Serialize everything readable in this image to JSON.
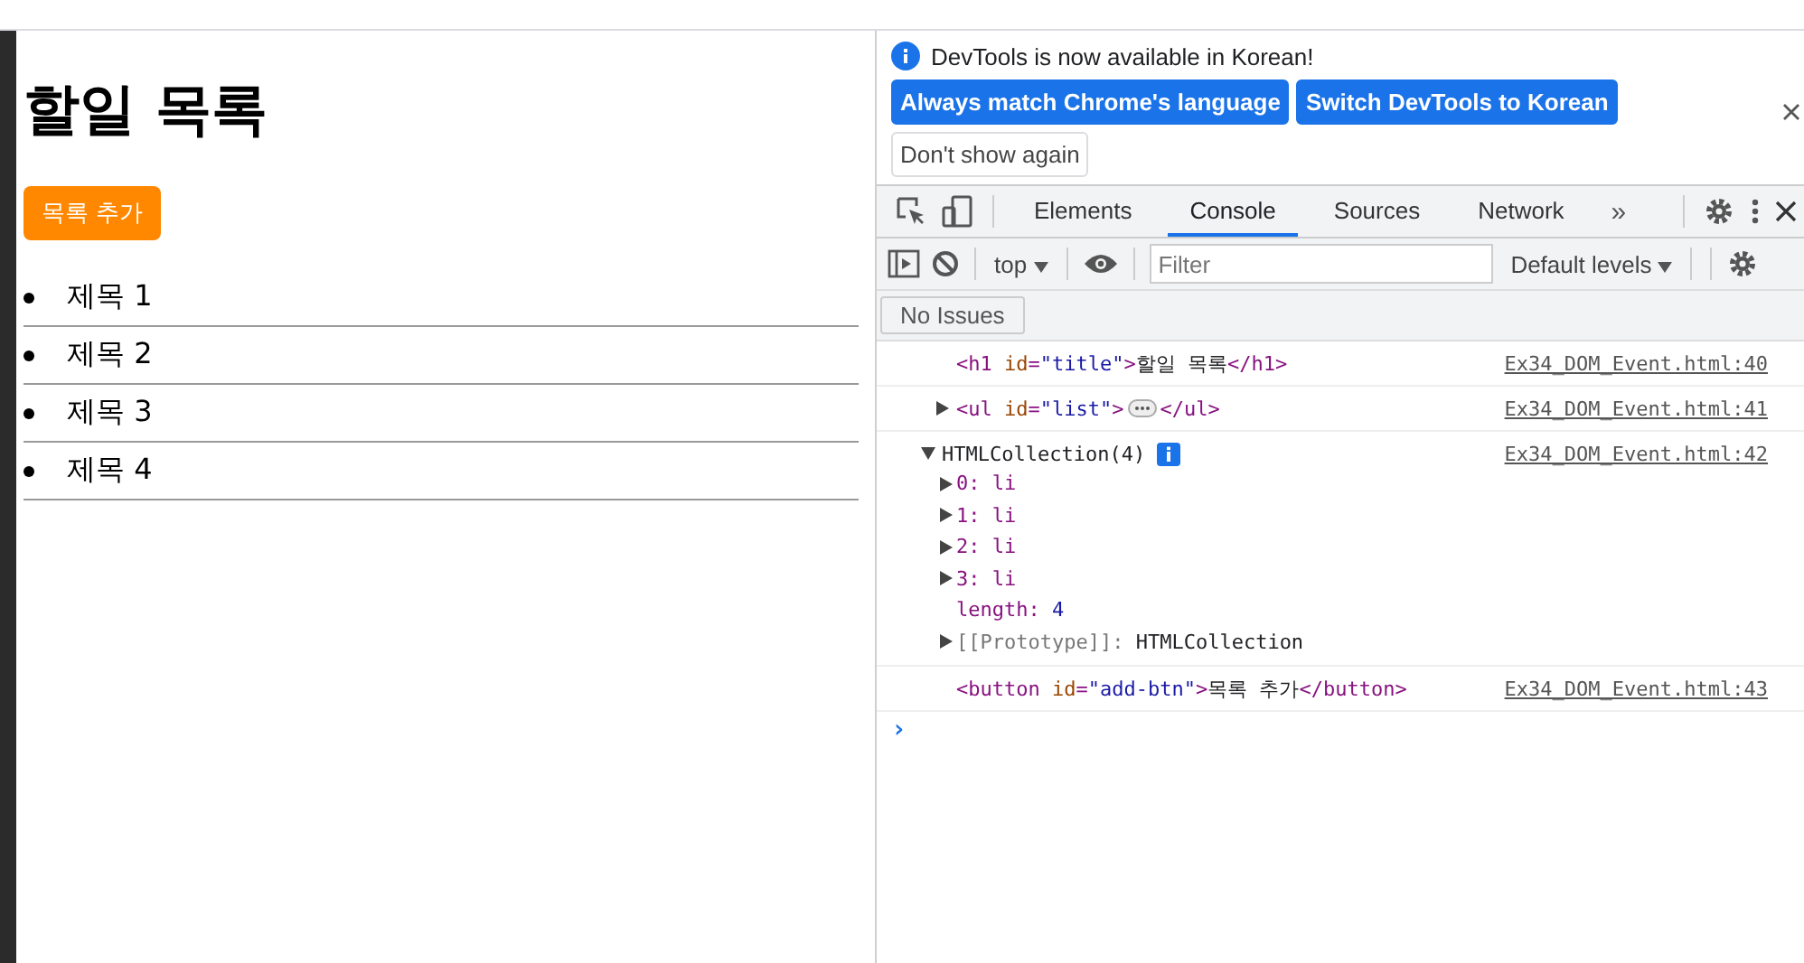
{
  "page": {
    "heading": "할일 목록",
    "add_button": "목록 추가",
    "items": [
      "제목 1",
      "제목 2",
      "제목 3",
      "제목 4"
    ]
  },
  "devtools": {
    "infobar": {
      "message": "DevTools is now available in Korean!",
      "buttons": [
        {
          "label": "Always match Chrome's language",
          "kind": "primary"
        },
        {
          "label": "Switch DevTools to Korean",
          "kind": "primary"
        },
        {
          "label": "Don't show again",
          "kind": "secondary"
        }
      ]
    },
    "tabs": [
      {
        "label": "Elements",
        "selected": false
      },
      {
        "label": "Console",
        "selected": true
      },
      {
        "label": "Sources",
        "selected": false
      },
      {
        "label": "Network",
        "selected": false
      }
    ],
    "more_tabs": "»",
    "context": "top",
    "filter": {
      "placeholder": "Filter"
    },
    "levels": "Default levels",
    "issues": "No Issues",
    "entries": [
      {
        "kind": "element",
        "tokens": [
          {
            "kind": "tag",
            "text": "<h1 "
          },
          {
            "kind": "attr",
            "text": "id"
          },
          {
            "kind": "tag",
            "text": "="
          },
          {
            "kind": "value",
            "text": "\"title\""
          },
          {
            "kind": "tag",
            "text": ">"
          },
          {
            "kind": "text",
            "text": "할일 목록"
          },
          {
            "kind": "tag",
            "text": "</h1>"
          }
        ],
        "source": "Ex34_DOM_Event.html:40"
      },
      {
        "kind": "collapsed",
        "tokens": [
          {
            "kind": "tag",
            "text": "<ul "
          },
          {
            "kind": "attr",
            "text": "id"
          },
          {
            "kind": "tag",
            "text": "="
          },
          {
            "kind": "value",
            "text": "\"list\""
          },
          {
            "kind": "tag",
            "text": ">"
          }
        ],
        "tokens_after": [
          {
            "kind": "tag",
            "text": "</ul>"
          }
        ],
        "source": "Ex34_DOM_Event.html:41"
      },
      {
        "kind": "expanded",
        "tokens": [
          {
            "kind": "text",
            "text": "HTMLCollection(4)"
          }
        ],
        "source": "Ex34_DOM_Event.html:42",
        "children": [
          {
            "key": "0:",
            "kind": "index",
            "value": "li"
          },
          {
            "key": "1:",
            "kind": "index",
            "value": "li"
          },
          {
            "key": "2:",
            "kind": "index",
            "value": "li"
          },
          {
            "key": "3:",
            "kind": "index",
            "value": "li"
          },
          {
            "key": "length:",
            "kind": "number",
            "value": "4"
          },
          {
            "key": "[[Prototype]]:",
            "kind": "internal",
            "value": "HTMLCollection"
          }
        ]
      },
      {
        "kind": "element",
        "tokens": [
          {
            "kind": "tag",
            "text": "<button "
          },
          {
            "kind": "attr",
            "text": "id"
          },
          {
            "kind": "tag",
            "text": "="
          },
          {
            "kind": "value",
            "text": "\"add-btn\""
          },
          {
            "kind": "tag",
            "text": ">"
          },
          {
            "kind": "text",
            "text": "목록 추가"
          },
          {
            "kind": "tag",
            "text": "</button>"
          }
        ],
        "source": "Ex34_DOM_Event.html:43"
      }
    ],
    "prompt": "›"
  }
}
